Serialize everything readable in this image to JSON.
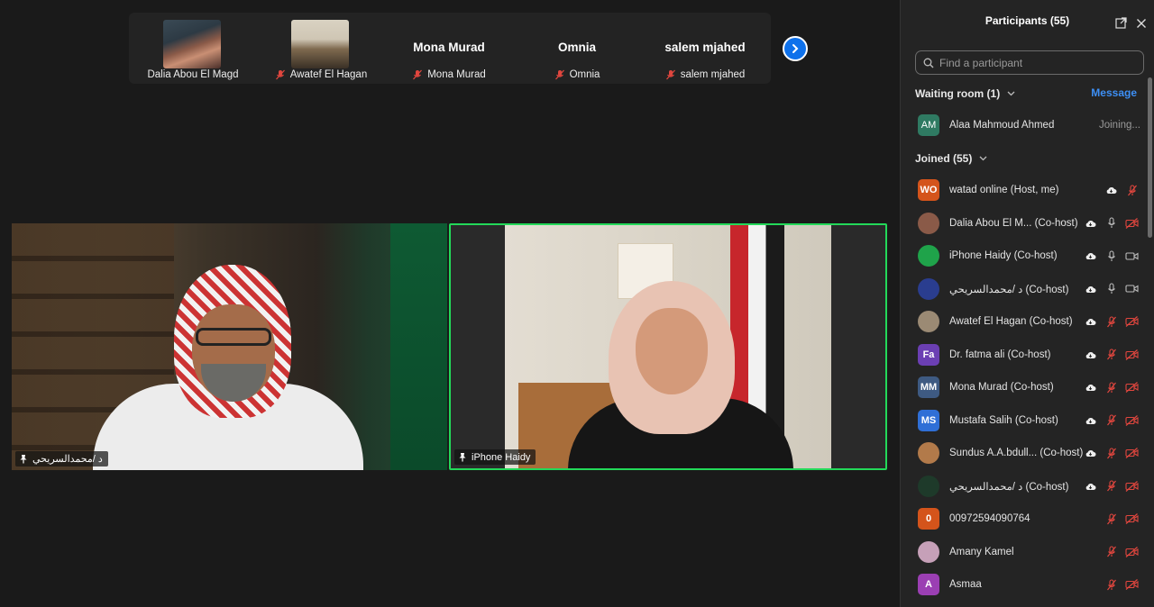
{
  "gallery": {
    "tiles": [
      {
        "name_big": "",
        "label": "Dalia Abou El Magd",
        "muted": false,
        "has_thumb": true
      },
      {
        "name_big": "",
        "label": "Awatef El Hagan",
        "muted": true,
        "has_thumb": true
      },
      {
        "name_big": "Mona Murad",
        "label": "Mona Murad",
        "muted": true,
        "has_thumb": false
      },
      {
        "name_big": "Omnia",
        "label": "Omnia",
        "muted": true,
        "has_thumb": false
      },
      {
        "name_big": "salem mjahed",
        "label": "salem mjahed",
        "muted": true,
        "has_thumb": false
      }
    ],
    "next_icon": "chevron-right-icon"
  },
  "videos": {
    "left_name": "د /محمدالسريحي",
    "right_name": "iPhone Haidy"
  },
  "participants": {
    "title": "Participants (55)",
    "search_placeholder": "Find a participant",
    "waiting_room_label": "Waiting room (1)",
    "message_label": "Message",
    "waiting": [
      {
        "initials": "AM",
        "name": "Alaa Mahmoud Ahmed",
        "status": "Joining...",
        "color": "#2f7a62"
      }
    ],
    "joined_label": "Joined (55)",
    "joined": [
      {
        "initials": "WO",
        "name": "watad online (Host, me)",
        "color": "#d4541b"
      },
      {
        "initials": "",
        "name": "Dalia Abou El M...  (Co-host)",
        "color": "#8a5a48"
      },
      {
        "initials": "",
        "name": "iPhone Haidy (Co-host)",
        "color": "#1fa34a"
      },
      {
        "initials": "",
        "name": "د /محمدالسريحي (Co-host)",
        "color": "#2a3d8f"
      },
      {
        "initials": "",
        "name": "Awatef El Hagan (Co-host)",
        "color": "#9b8a74"
      },
      {
        "initials": "Fa",
        "name": "Dr. fatma  ali (Co-host)",
        "color": "#6b3fb3"
      },
      {
        "initials": "MM",
        "name": "Mona Murad (Co-host)",
        "color": "#3e5a82"
      },
      {
        "initials": "MS",
        "name": "Mustafa Salih (Co-host)",
        "color": "#2f6fd6"
      },
      {
        "initials": "",
        "name": "Sundus A.A.bdull...  (Co-host)",
        "color": "#b27a4a"
      },
      {
        "initials": "",
        "name": "د /محمدالسريحي (Co-host)",
        "color": "#1e3a2a"
      },
      {
        "initials": "0",
        "name": "00972594090764",
        "color": "#d4541b"
      },
      {
        "initials": "",
        "name": "Amany Kamel",
        "color": "#c6a0b8"
      },
      {
        "initials": "A",
        "name": "Asmaa",
        "color": "#9b3fb3"
      }
    ],
    "colors": {
      "accent": "#0e71eb",
      "muted_red": "#e0463e",
      "link": "#3d8ff5",
      "speaker_border": "#23d959"
    }
  }
}
